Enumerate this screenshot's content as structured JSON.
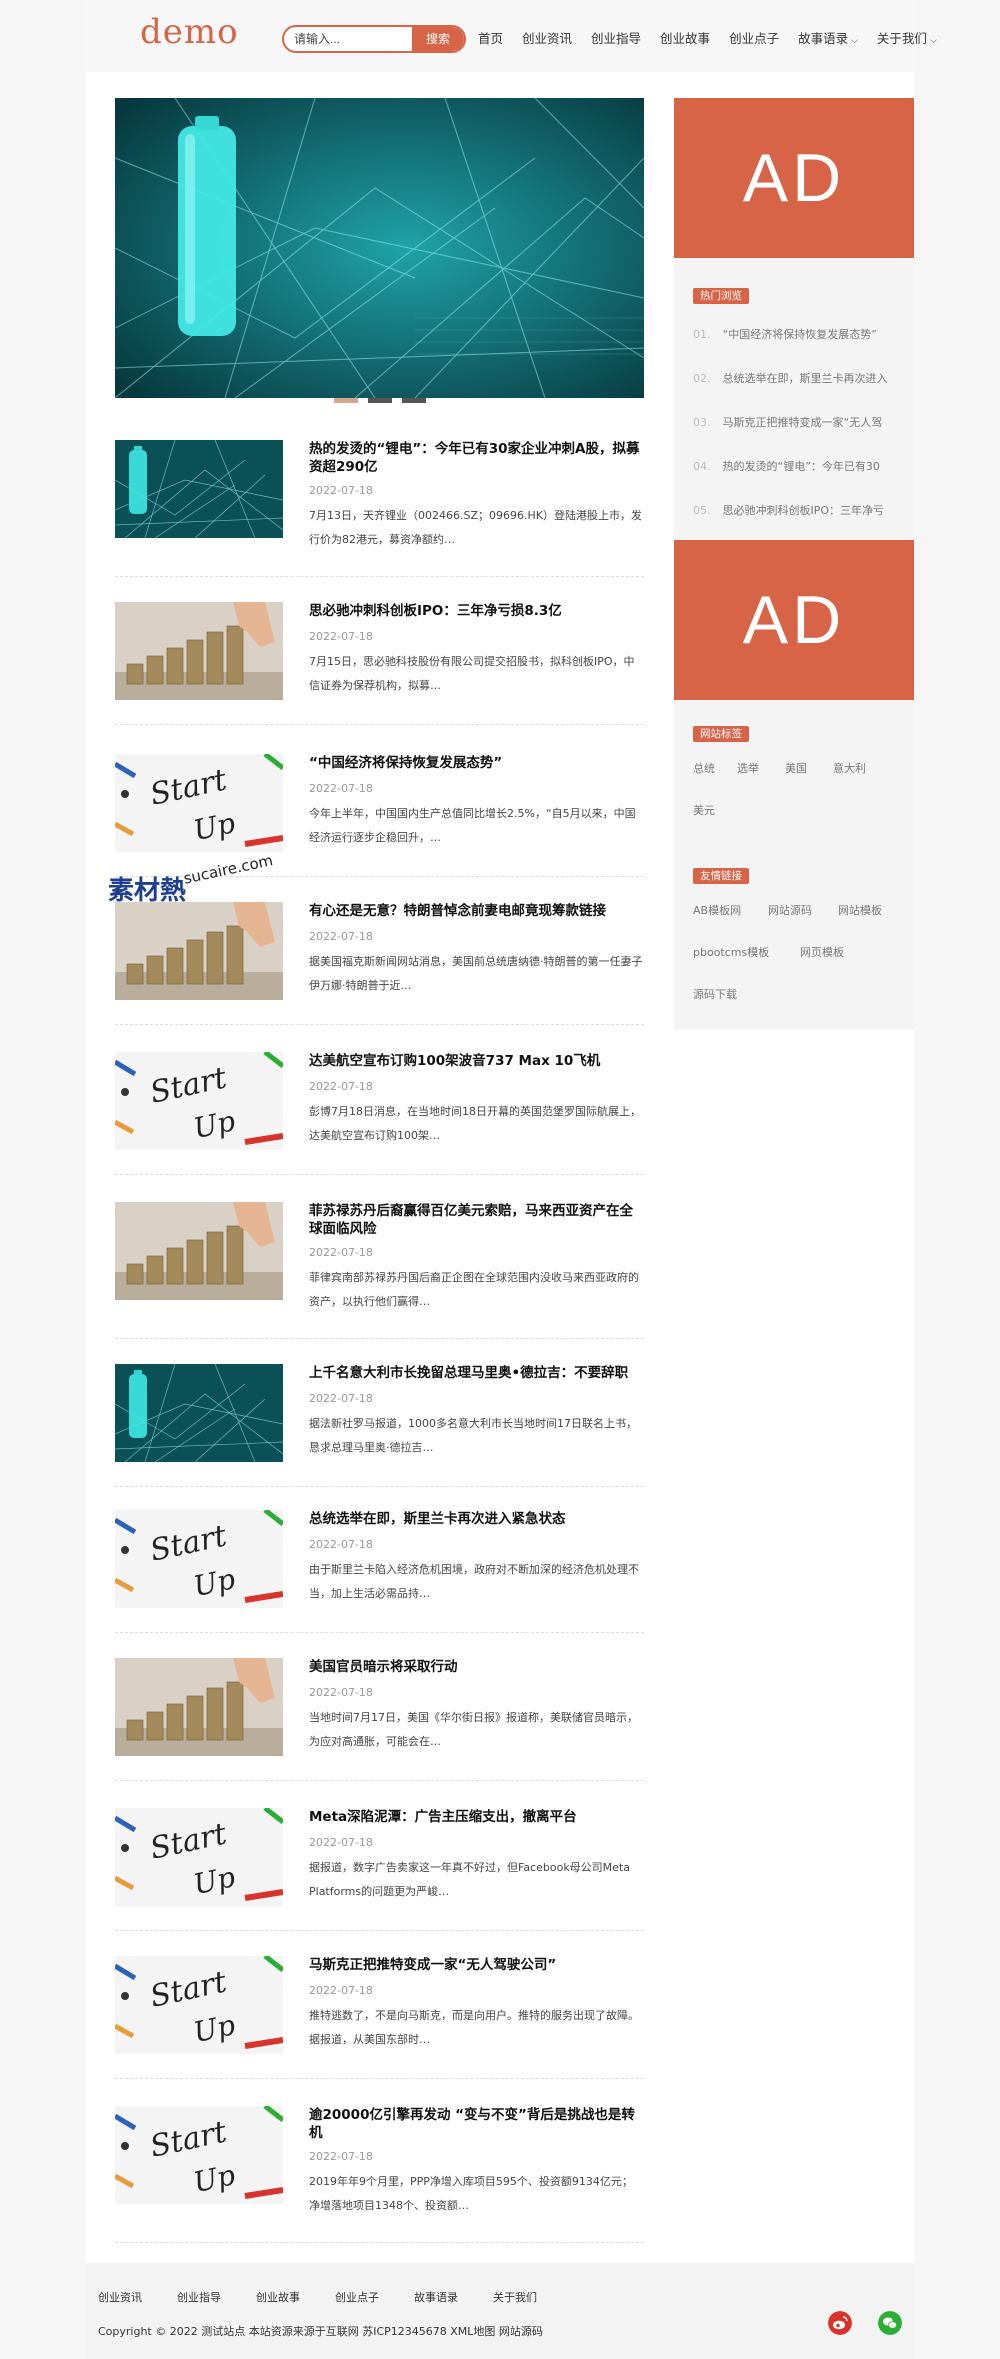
{
  "header": {
    "logo": "demo",
    "search_placeholder": "请输入...",
    "search_button": "搜索",
    "nav": [
      "首页",
      "创业资讯",
      "创业指导",
      "创业故事",
      "创业点子",
      "故事语录",
      "关于我们"
    ]
  },
  "articles": [
    {
      "title": "热的发烫的“锂电”：今年已有30家企业冲刺A股，拟募资超290亿",
      "date": "2022-07-18",
      "desc": "7月13日，天齐锂业（002466.SZ；09696.HK）登陆港股上市，发行价为82港元，募资净额约…"
    },
    {
      "title": "思必驰冲刺科创板IPO：三年净亏损8.3亿",
      "date": "2022-07-18",
      "desc": "7月15日，思必驰科技股份有限公司提交招股书，拟科创板IPO，中信证券为保荐机构，拟募…"
    },
    {
      "title": "“中国经济将保持恢复发展态势”",
      "date": "2022-07-18",
      "desc": "今年上半年，中国国内生产总值同比增长2.5%，“自5月以来，中国经济运行逐步企稳回升，…"
    },
    {
      "title": "有心还是无意？特朗普悼念前妻电邮竟现筹款链接",
      "date": "2022-07-18",
      "desc": "据美国福克斯新闻网站消息，美国前总统唐纳德·特朗普的第一任妻子伊万娜·特朗普于近…"
    },
    {
      "title": "达美航空宣布订购100架波音737 Max 10飞机",
      "date": "2022-07-18",
      "desc": "彭博7月18日消息，在当地时间18日开幕的英国范堡罗国际航展上，达美航空宣布订购100架…"
    },
    {
      "title": "菲苏禄苏丹后裔赢得百亿美元索赔，马来西亚资产在全球面临风险",
      "date": "2022-07-18",
      "desc": "菲律宾南部苏禄苏丹国后裔正企图在全球范围内没收马来西亚政府的资产，以执行他们赢得…"
    },
    {
      "title": "上千名意大利市长挽留总理马里奥•德拉吉：不要辞职",
      "date": "2022-07-18",
      "desc": "据法新社罗马报道，1000多名意大利市长当地时间17日联名上书，恳求总理马里奥·德拉吉…"
    },
    {
      "title": "总统选举在即，斯里兰卡再次进入紧急状态",
      "date": "2022-07-18",
      "desc": "由于斯里兰卡陷入经济危机困境，政府对不断加深的经济危机处理不当，加上生活必需品持…"
    },
    {
      "title": "美国官员暗示将采取行动",
      "date": "2022-07-18",
      "desc": "当地时间7月17日，美国《华尔街日报》报道称，美联储官员暗示，为应对高通胀，可能会在…"
    },
    {
      "title": "Meta深陷泥潭：广告主压缩支出，撤离平台",
      "date": "2022-07-18",
      "desc": "据报道，数字广告卖家这一年真不好过，但Facebook母公司Meta Platforms的问题更为严峻…"
    },
    {
      "title": "马斯克正把推特变成一家“无人驾驶公司”",
      "date": "2022-07-18",
      "desc": "推特逃数了，不是向马斯克，而是向用户。推特的服务出现了故障。据报道，从美国东部时…"
    },
    {
      "title": "逾20000亿引擎再发动 “变与不变”背后是挑战也是转机",
      "date": "2022-07-18",
      "desc": "2019年年9个月里，PPP净增入库项目595个、投资额9134亿元；净增落地项目1348个、投资额…"
    }
  ],
  "sidebar": {
    "ad_text": "AD",
    "hot_label": "热门浏览",
    "hot": [
      {
        "num": "01.",
        "text": "“中国经济将保持恢复发展态势”"
      },
      {
        "num": "02.",
        "text": "总统选举在即，斯里兰卡再次进入"
      },
      {
        "num": "03.",
        "text": "马斯克正把推特变成一家“无人驾"
      },
      {
        "num": "04.",
        "text": "热的发烫的“锂电”：今年已有30"
      },
      {
        "num": "05.",
        "text": "思必驰冲刺科创板IPO：三年净亏"
      }
    ],
    "tags_label": "网站标签",
    "tags": [
      "总统",
      "选举",
      "美国",
      "意大利",
      "美元"
    ],
    "links_label": "友情链接",
    "links": [
      "AB模板网",
      "网站源码",
      "网站模板",
      "pbootcms模板",
      "网页模板",
      "源码下载"
    ]
  },
  "footer": {
    "links": [
      "创业资讯",
      "创业指导",
      "创业故事",
      "创业点子",
      "故事语录",
      "关于我们"
    ],
    "copyright": "Copyright © 2022 测试站点 本站资源来源于互联网 苏ICP12345678 XML地图 网站源码"
  },
  "watermark": {
    "main": "素材熱",
    "sub": "sucaire.com"
  },
  "colors": {
    "accent": "#d86447",
    "banner": "#0c4f56",
    "wechat": "#2aae35"
  }
}
